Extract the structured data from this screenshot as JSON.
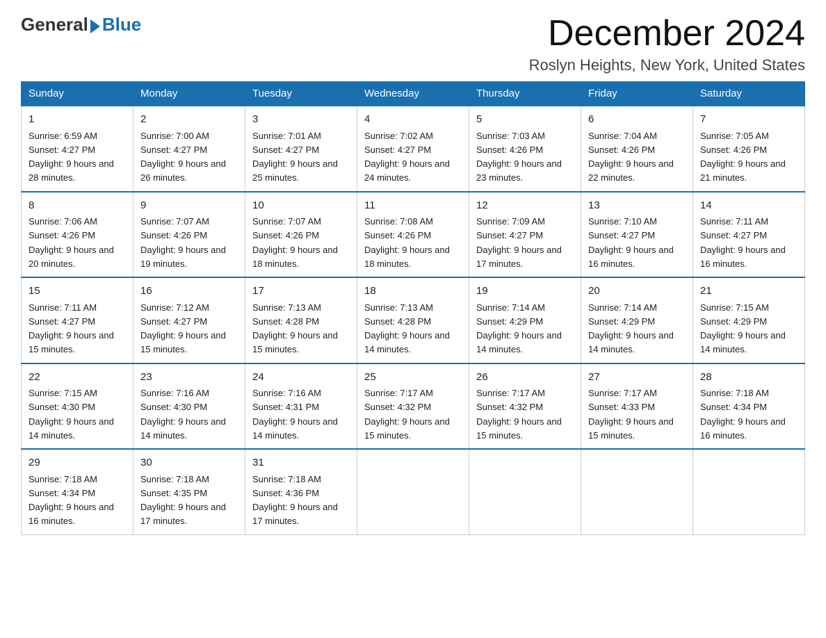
{
  "header": {
    "logo_general": "General",
    "logo_blue": "Blue",
    "month_title": "December 2024",
    "location": "Roslyn Heights, New York, United States"
  },
  "days_of_week": [
    "Sunday",
    "Monday",
    "Tuesday",
    "Wednesday",
    "Thursday",
    "Friday",
    "Saturday"
  ],
  "weeks": [
    [
      {
        "day": "1",
        "sunrise": "6:59 AM",
        "sunset": "4:27 PM",
        "daylight": "9 hours and 28 minutes."
      },
      {
        "day": "2",
        "sunrise": "7:00 AM",
        "sunset": "4:27 PM",
        "daylight": "9 hours and 26 minutes."
      },
      {
        "day": "3",
        "sunrise": "7:01 AM",
        "sunset": "4:27 PM",
        "daylight": "9 hours and 25 minutes."
      },
      {
        "day": "4",
        "sunrise": "7:02 AM",
        "sunset": "4:27 PM",
        "daylight": "9 hours and 24 minutes."
      },
      {
        "day": "5",
        "sunrise": "7:03 AM",
        "sunset": "4:26 PM",
        "daylight": "9 hours and 23 minutes."
      },
      {
        "day": "6",
        "sunrise": "7:04 AM",
        "sunset": "4:26 PM",
        "daylight": "9 hours and 22 minutes."
      },
      {
        "day": "7",
        "sunrise": "7:05 AM",
        "sunset": "4:26 PM",
        "daylight": "9 hours and 21 minutes."
      }
    ],
    [
      {
        "day": "8",
        "sunrise": "7:06 AM",
        "sunset": "4:26 PM",
        "daylight": "9 hours and 20 minutes."
      },
      {
        "day": "9",
        "sunrise": "7:07 AM",
        "sunset": "4:26 PM",
        "daylight": "9 hours and 19 minutes."
      },
      {
        "day": "10",
        "sunrise": "7:07 AM",
        "sunset": "4:26 PM",
        "daylight": "9 hours and 18 minutes."
      },
      {
        "day": "11",
        "sunrise": "7:08 AM",
        "sunset": "4:26 PM",
        "daylight": "9 hours and 18 minutes."
      },
      {
        "day": "12",
        "sunrise": "7:09 AM",
        "sunset": "4:27 PM",
        "daylight": "9 hours and 17 minutes."
      },
      {
        "day": "13",
        "sunrise": "7:10 AM",
        "sunset": "4:27 PM",
        "daylight": "9 hours and 16 minutes."
      },
      {
        "day": "14",
        "sunrise": "7:11 AM",
        "sunset": "4:27 PM",
        "daylight": "9 hours and 16 minutes."
      }
    ],
    [
      {
        "day": "15",
        "sunrise": "7:11 AM",
        "sunset": "4:27 PM",
        "daylight": "9 hours and 15 minutes."
      },
      {
        "day": "16",
        "sunrise": "7:12 AM",
        "sunset": "4:27 PM",
        "daylight": "9 hours and 15 minutes."
      },
      {
        "day": "17",
        "sunrise": "7:13 AM",
        "sunset": "4:28 PM",
        "daylight": "9 hours and 15 minutes."
      },
      {
        "day": "18",
        "sunrise": "7:13 AM",
        "sunset": "4:28 PM",
        "daylight": "9 hours and 14 minutes."
      },
      {
        "day": "19",
        "sunrise": "7:14 AM",
        "sunset": "4:29 PM",
        "daylight": "9 hours and 14 minutes."
      },
      {
        "day": "20",
        "sunrise": "7:14 AM",
        "sunset": "4:29 PM",
        "daylight": "9 hours and 14 minutes."
      },
      {
        "day": "21",
        "sunrise": "7:15 AM",
        "sunset": "4:29 PM",
        "daylight": "9 hours and 14 minutes."
      }
    ],
    [
      {
        "day": "22",
        "sunrise": "7:15 AM",
        "sunset": "4:30 PM",
        "daylight": "9 hours and 14 minutes."
      },
      {
        "day": "23",
        "sunrise": "7:16 AM",
        "sunset": "4:30 PM",
        "daylight": "9 hours and 14 minutes."
      },
      {
        "day": "24",
        "sunrise": "7:16 AM",
        "sunset": "4:31 PM",
        "daylight": "9 hours and 14 minutes."
      },
      {
        "day": "25",
        "sunrise": "7:17 AM",
        "sunset": "4:32 PM",
        "daylight": "9 hours and 15 minutes."
      },
      {
        "day": "26",
        "sunrise": "7:17 AM",
        "sunset": "4:32 PM",
        "daylight": "9 hours and 15 minutes."
      },
      {
        "day": "27",
        "sunrise": "7:17 AM",
        "sunset": "4:33 PM",
        "daylight": "9 hours and 15 minutes."
      },
      {
        "day": "28",
        "sunrise": "7:18 AM",
        "sunset": "4:34 PM",
        "daylight": "9 hours and 16 minutes."
      }
    ],
    [
      {
        "day": "29",
        "sunrise": "7:18 AM",
        "sunset": "4:34 PM",
        "daylight": "9 hours and 16 minutes."
      },
      {
        "day": "30",
        "sunrise": "7:18 AM",
        "sunset": "4:35 PM",
        "daylight": "9 hours and 17 minutes."
      },
      {
        "day": "31",
        "sunrise": "7:18 AM",
        "sunset": "4:36 PM",
        "daylight": "9 hours and 17 minutes."
      },
      null,
      null,
      null,
      null
    ]
  ],
  "labels": {
    "sunrise_prefix": "Sunrise: ",
    "sunset_prefix": "Sunset: ",
    "daylight_prefix": "Daylight: "
  }
}
